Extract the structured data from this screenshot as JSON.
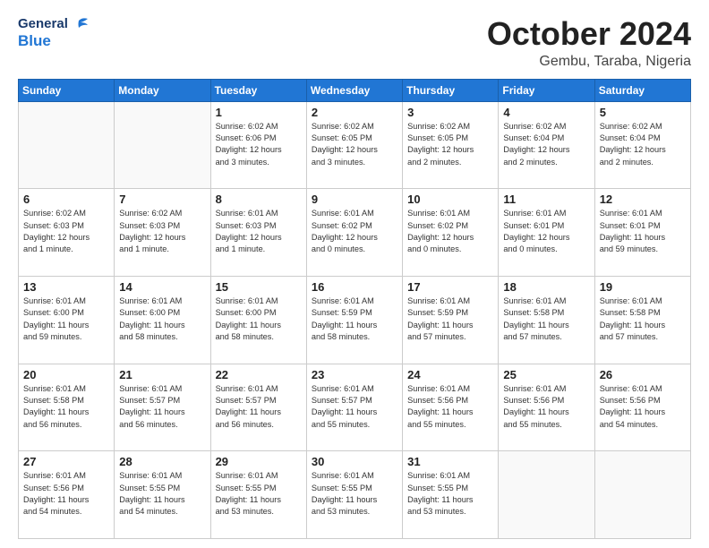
{
  "header": {
    "logo_general": "General",
    "logo_blue": "Blue",
    "month": "October 2024",
    "location": "Gembu, Taraba, Nigeria"
  },
  "days_of_week": [
    "Sunday",
    "Monday",
    "Tuesday",
    "Wednesday",
    "Thursday",
    "Friday",
    "Saturday"
  ],
  "weeks": [
    [
      {
        "day": "",
        "info": ""
      },
      {
        "day": "",
        "info": ""
      },
      {
        "day": "1",
        "info": "Sunrise: 6:02 AM\nSunset: 6:06 PM\nDaylight: 12 hours\nand 3 minutes."
      },
      {
        "day": "2",
        "info": "Sunrise: 6:02 AM\nSunset: 6:05 PM\nDaylight: 12 hours\nand 3 minutes."
      },
      {
        "day": "3",
        "info": "Sunrise: 6:02 AM\nSunset: 6:05 PM\nDaylight: 12 hours\nand 2 minutes."
      },
      {
        "day": "4",
        "info": "Sunrise: 6:02 AM\nSunset: 6:04 PM\nDaylight: 12 hours\nand 2 minutes."
      },
      {
        "day": "5",
        "info": "Sunrise: 6:02 AM\nSunset: 6:04 PM\nDaylight: 12 hours\nand 2 minutes."
      }
    ],
    [
      {
        "day": "6",
        "info": "Sunrise: 6:02 AM\nSunset: 6:03 PM\nDaylight: 12 hours\nand 1 minute."
      },
      {
        "day": "7",
        "info": "Sunrise: 6:02 AM\nSunset: 6:03 PM\nDaylight: 12 hours\nand 1 minute."
      },
      {
        "day": "8",
        "info": "Sunrise: 6:01 AM\nSunset: 6:03 PM\nDaylight: 12 hours\nand 1 minute."
      },
      {
        "day": "9",
        "info": "Sunrise: 6:01 AM\nSunset: 6:02 PM\nDaylight: 12 hours\nand 0 minutes."
      },
      {
        "day": "10",
        "info": "Sunrise: 6:01 AM\nSunset: 6:02 PM\nDaylight: 12 hours\nand 0 minutes."
      },
      {
        "day": "11",
        "info": "Sunrise: 6:01 AM\nSunset: 6:01 PM\nDaylight: 12 hours\nand 0 minutes."
      },
      {
        "day": "12",
        "info": "Sunrise: 6:01 AM\nSunset: 6:01 PM\nDaylight: 11 hours\nand 59 minutes."
      }
    ],
    [
      {
        "day": "13",
        "info": "Sunrise: 6:01 AM\nSunset: 6:00 PM\nDaylight: 11 hours\nand 59 minutes."
      },
      {
        "day": "14",
        "info": "Sunrise: 6:01 AM\nSunset: 6:00 PM\nDaylight: 11 hours\nand 58 minutes."
      },
      {
        "day": "15",
        "info": "Sunrise: 6:01 AM\nSunset: 6:00 PM\nDaylight: 11 hours\nand 58 minutes."
      },
      {
        "day": "16",
        "info": "Sunrise: 6:01 AM\nSunset: 5:59 PM\nDaylight: 11 hours\nand 58 minutes."
      },
      {
        "day": "17",
        "info": "Sunrise: 6:01 AM\nSunset: 5:59 PM\nDaylight: 11 hours\nand 57 minutes."
      },
      {
        "day": "18",
        "info": "Sunrise: 6:01 AM\nSunset: 5:58 PM\nDaylight: 11 hours\nand 57 minutes."
      },
      {
        "day": "19",
        "info": "Sunrise: 6:01 AM\nSunset: 5:58 PM\nDaylight: 11 hours\nand 57 minutes."
      }
    ],
    [
      {
        "day": "20",
        "info": "Sunrise: 6:01 AM\nSunset: 5:58 PM\nDaylight: 11 hours\nand 56 minutes."
      },
      {
        "day": "21",
        "info": "Sunrise: 6:01 AM\nSunset: 5:57 PM\nDaylight: 11 hours\nand 56 minutes."
      },
      {
        "day": "22",
        "info": "Sunrise: 6:01 AM\nSunset: 5:57 PM\nDaylight: 11 hours\nand 56 minutes."
      },
      {
        "day": "23",
        "info": "Sunrise: 6:01 AM\nSunset: 5:57 PM\nDaylight: 11 hours\nand 55 minutes."
      },
      {
        "day": "24",
        "info": "Sunrise: 6:01 AM\nSunset: 5:56 PM\nDaylight: 11 hours\nand 55 minutes."
      },
      {
        "day": "25",
        "info": "Sunrise: 6:01 AM\nSunset: 5:56 PM\nDaylight: 11 hours\nand 55 minutes."
      },
      {
        "day": "26",
        "info": "Sunrise: 6:01 AM\nSunset: 5:56 PM\nDaylight: 11 hours\nand 54 minutes."
      }
    ],
    [
      {
        "day": "27",
        "info": "Sunrise: 6:01 AM\nSunset: 5:56 PM\nDaylight: 11 hours\nand 54 minutes."
      },
      {
        "day": "28",
        "info": "Sunrise: 6:01 AM\nSunset: 5:55 PM\nDaylight: 11 hours\nand 54 minutes."
      },
      {
        "day": "29",
        "info": "Sunrise: 6:01 AM\nSunset: 5:55 PM\nDaylight: 11 hours\nand 53 minutes."
      },
      {
        "day": "30",
        "info": "Sunrise: 6:01 AM\nSunset: 5:55 PM\nDaylight: 11 hours\nand 53 minutes."
      },
      {
        "day": "31",
        "info": "Sunrise: 6:01 AM\nSunset: 5:55 PM\nDaylight: 11 hours\nand 53 minutes."
      },
      {
        "day": "",
        "info": ""
      },
      {
        "day": "",
        "info": ""
      }
    ]
  ]
}
